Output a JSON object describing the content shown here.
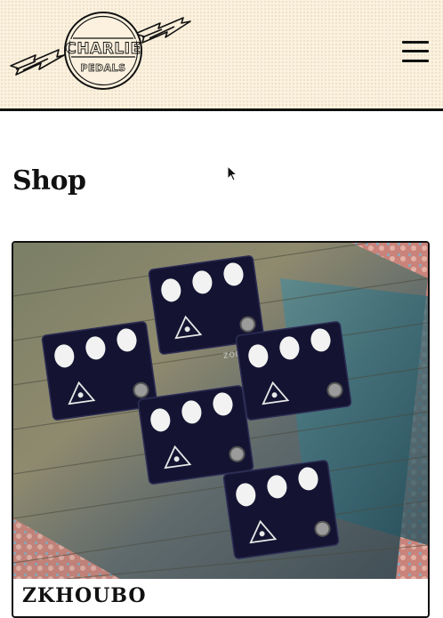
{
  "header": {
    "logo": {
      "line1": "CHARLIE",
      "line2": "PEDALS"
    }
  },
  "page": {
    "title": "Shop"
  },
  "products": [
    {
      "name": "ZKHOUBO",
      "pedal_label": "ZODIAC"
    }
  ],
  "colors": {
    "header_bg": "#fbf1de",
    "ink": "#111111",
    "pedal": "#141432",
    "knob": "#f2f2f2"
  }
}
